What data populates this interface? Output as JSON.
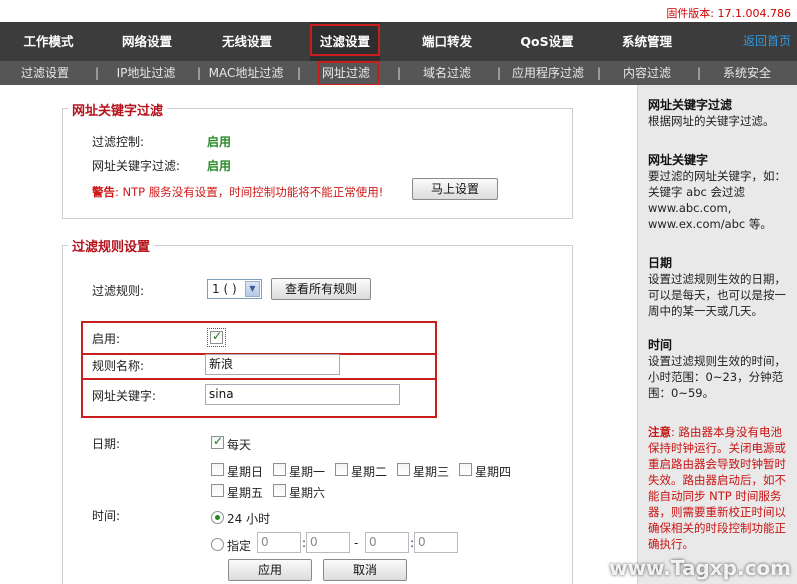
{
  "header": {
    "firmware_label": "固件版本: 17.1.004.786"
  },
  "main_nav": {
    "items": [
      "工作模式",
      "网络设置",
      "无线设置",
      "过滤设置",
      "端口转发",
      "QoS设置",
      "系统管理"
    ],
    "back_link": "返回首页"
  },
  "sub_nav": {
    "items": [
      "过滤设置",
      "IP地址过滤",
      "MAC地址过滤",
      "网址过滤",
      "域名过滤",
      "应用程序过滤",
      "内容过滤",
      "系统安全"
    ],
    "separator": "|"
  },
  "keyword_section": {
    "title": "网址关键字过滤",
    "time_control_label": "过滤控制:",
    "time_control_value": "启用",
    "keyword_filter_label": "网址关键字过滤:",
    "keyword_filter_value": "启用",
    "warning_prefix": "警告",
    "warning_text": ": NTP 服务没有设置，时间控制功能将不能正常使用!",
    "setup_button": "马上设置"
  },
  "rule_section": {
    "title": "过滤规则设置",
    "rule_label": "过滤规则:",
    "rule_selected": "1 ( )",
    "view_all_button": "查看所有规则",
    "enable_label": "启用:",
    "enable_checked": true,
    "rule_name_label": "规则名称:",
    "rule_name_value": "新浪",
    "keyword_label": "网址关键字:",
    "keyword_value": "sina",
    "date_label": "日期:",
    "everyday_label": "每天",
    "everyday_checked": true,
    "weekdays": [
      "星期日",
      "星期一",
      "星期二",
      "星期三",
      "星期四",
      "星期五",
      "星期六"
    ],
    "time_label": "时间:",
    "time_24h_label": "24 小时",
    "time_custom_label": "指定",
    "time_fields": [
      "0",
      "0",
      "0",
      "0"
    ],
    "time_colon": ":",
    "time_dash": "-",
    "apply_button": "应用",
    "cancel_button": "取消"
  },
  "sidebar": {
    "h1": "网址关键字过滤",
    "p1": "根据网址的关键字过滤。",
    "h2": "网址关键字",
    "p2": "要过滤的网址关键字，如：关键字 abc 会过滤 www.abc.com, www.ex.com/abc 等。",
    "h3": "日期",
    "p3": "设置过滤规则生效的日期，可以是每天，也可以是按一周中的某一天或几天。",
    "h4": "时间",
    "p4": "设置过滤规则生效的时间，小时范围：0~23，分钟范围：0~59。",
    "note_prefix": "注意",
    "note_text": ": 路由器本身没有电池保持时钟运行。关闭电源或重启路由器会导致时钟暂时失效。路由器启动后，如不能自动同步 NTP 时间服务器，则需要重新校正时间以确保相关的时段控制功能正确执行。"
  },
  "watermark": "www.Tagxp.com"
}
